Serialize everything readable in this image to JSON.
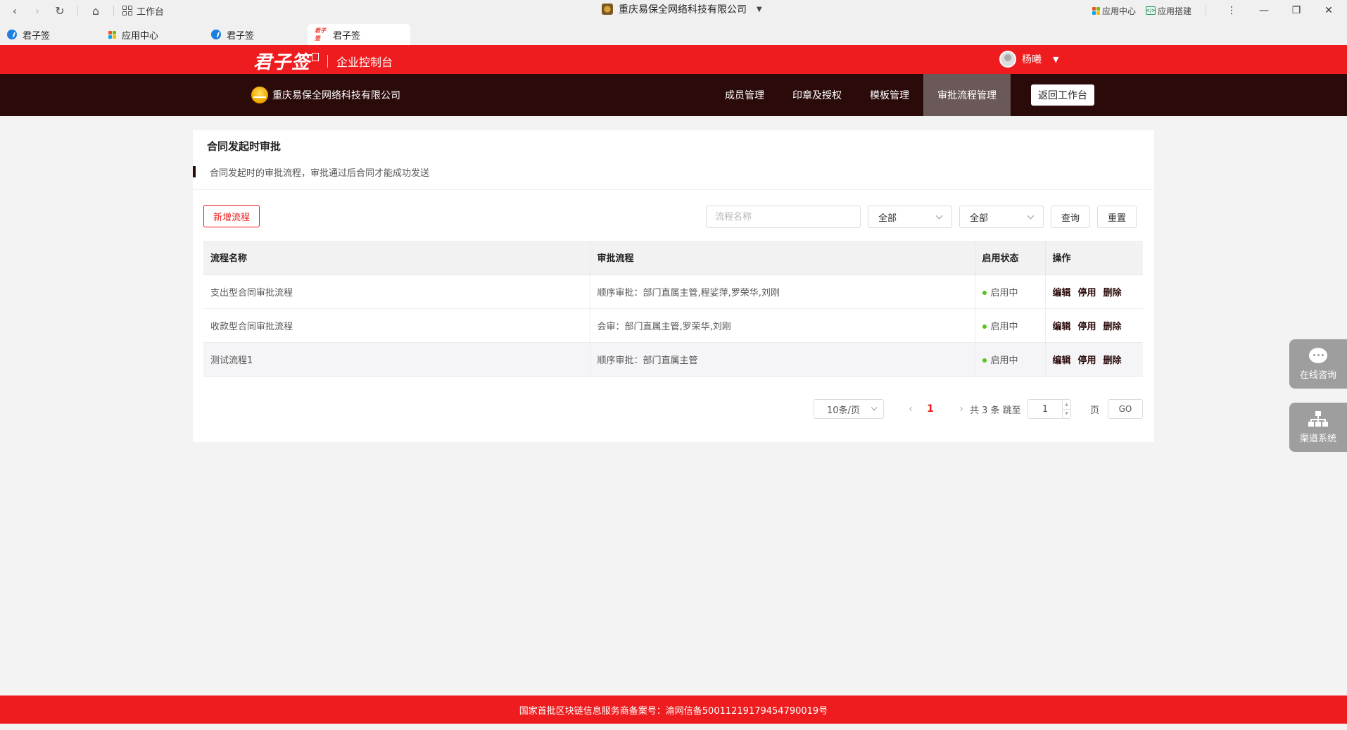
{
  "browser": {
    "workbench_label": "工作台",
    "window_title": "重庆易保全网络科技有限公司",
    "app_center_label": "应用中心",
    "app_build_label": "应用搭建",
    "tabs": [
      {
        "label": "君子签"
      },
      {
        "label": "应用中心"
      },
      {
        "label": "君子签"
      },
      {
        "label": "君子签"
      }
    ]
  },
  "header": {
    "brand": "君子签",
    "brand_sub": "企业控制台",
    "user_name": "杨曦"
  },
  "nav": {
    "company": "重庆易保全网络科技有限公司",
    "items": [
      {
        "label": "成员管理"
      },
      {
        "label": "印章及授权"
      },
      {
        "label": "模板管理"
      },
      {
        "label": "审批流程管理"
      }
    ],
    "back_label": "返回工作台"
  },
  "card": {
    "title": "合同发起时审批",
    "desc": "合同发起时的审批流程，审批通过后合同才能成功发送",
    "add_label": "新增流程",
    "search_placeholder": "流程名称",
    "select1": "全部",
    "select2": "全部",
    "query_label": "查询",
    "reset_label": "重置"
  },
  "table": {
    "headers": [
      "流程名称",
      "审批流程",
      "启用状态",
      "操作"
    ],
    "rows": [
      {
        "name": "支出型合同审批流程",
        "flow": "顺序审批：部门直属主管,程娑萍,罗荣华,刘刚",
        "status": "启用中"
      },
      {
        "name": "收款型合同审批流程",
        "flow": "会审：部门直属主管,罗荣华,刘刚",
        "status": "启用中"
      },
      {
        "name": "测试流程1",
        "flow": "顺序审批：部门直属主管",
        "status": "启用中"
      }
    ],
    "ops": {
      "edit": "编辑",
      "disable": "停用",
      "delete": "删除"
    }
  },
  "pager": {
    "page_size": "10条/页",
    "current": "1",
    "total": "共 3 条 跳至",
    "jump_value": "1",
    "unit": "页",
    "go": "GO"
  },
  "float": {
    "consult": "在线咨询",
    "channel": "渠道系统"
  },
  "footer": {
    "text": "国家首批区块链信息服务商备案号：渝网信备50011219179454790019号"
  }
}
